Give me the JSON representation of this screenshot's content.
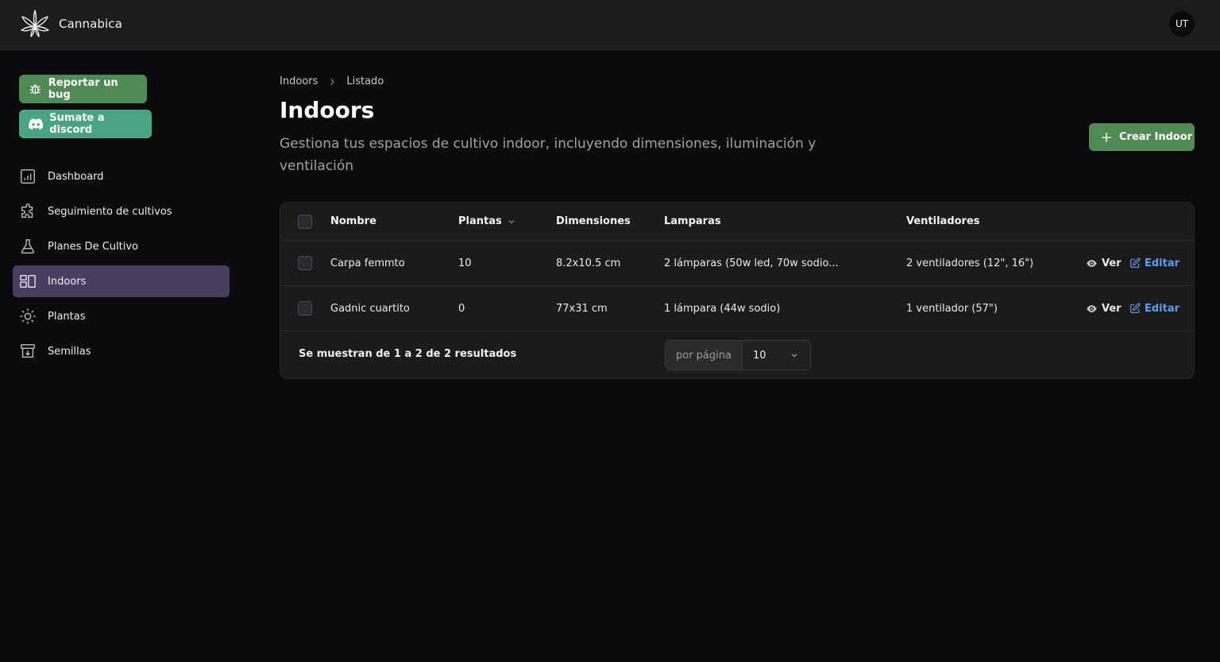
{
  "app": {
    "name": "Cannabica",
    "user_initials": "UT"
  },
  "sidebar": {
    "bug_button": "Reportar un bug",
    "discord_button": "Sumate a discord",
    "items": [
      {
        "label": "Dashboard",
        "icon": "chart-icon"
      },
      {
        "label": "Seguimiento de cultivos",
        "icon": "puzzle-icon"
      },
      {
        "label": "Planes De Cultivo",
        "icon": "flask-icon"
      },
      {
        "label": "Indoors",
        "icon": "layout-icon",
        "active": true
      },
      {
        "label": "Plantas",
        "icon": "sun-icon"
      },
      {
        "label": "Semillas",
        "icon": "archive-icon"
      }
    ]
  },
  "breadcrumb": {
    "root": "Indoors",
    "current": "Listado"
  },
  "header": {
    "title": "Indoors",
    "subtitle": "Gestiona tus espacios de cultivo indoor, incluyendo dimensiones, iluminación y ventilación",
    "create_button": "Crear Indoor"
  },
  "table": {
    "columns": {
      "nombre": "Nombre",
      "plantas": "Plantas",
      "dimensiones": "Dimensiones",
      "lamparas": "Lamparas",
      "ventiladores": "Ventiladores"
    },
    "rows": [
      {
        "nombre": "Carpa femmto",
        "plantas": "10",
        "dimensiones": "8.2x10.5 cm",
        "lamparas": "2 lámparas (50w led, 70w sodio...",
        "ventiladores": "2 ventiladores (12\", 16\")"
      },
      {
        "nombre": "Gadnic cuartito",
        "plantas": "0",
        "dimensiones": "77x31 cm",
        "lamparas": "1 lámpara (44w sodio)",
        "ventiladores": "1 ventilador (57\")"
      }
    ],
    "actions": {
      "view": "Ver",
      "edit": "Editar"
    },
    "footer": {
      "summary": "Se muestran de 1 a 2 de 2 resultados",
      "per_page_label": "por página",
      "per_page_value": "10"
    }
  },
  "colors": {
    "accent_green": "#4f8a55",
    "discord_teal": "#4aa382",
    "active_nav": "#4a3d5f",
    "edit_link": "#5f9bf3"
  }
}
